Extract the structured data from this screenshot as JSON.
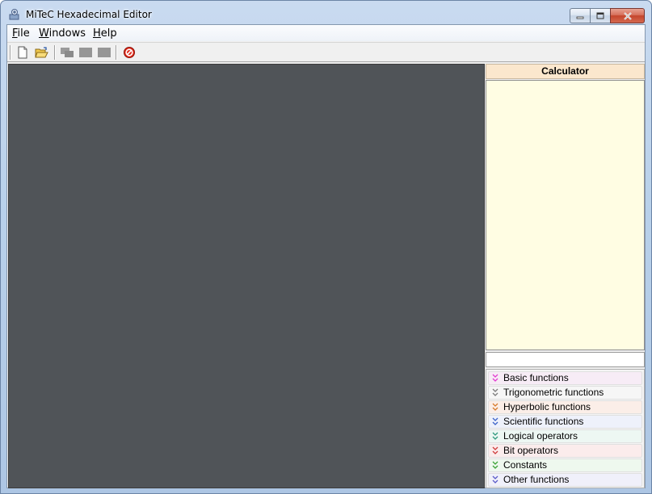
{
  "window": {
    "title": "MiTeC Hexadecimal Editor",
    "icons": [
      "app-icon",
      "minimize-icon",
      "maximize-icon",
      "close-icon"
    ]
  },
  "menubar": {
    "items": [
      {
        "label_ul": "F",
        "label_rest": "ile"
      },
      {
        "label_ul": "W",
        "label_rest": "indows"
      },
      {
        "label_ul": "H",
        "label_rest": "elp"
      }
    ]
  },
  "toolbar": {
    "buttons": [
      "new-file-icon",
      "open-folder-icon",
      "cascade-icon",
      "tile-icon",
      "arrange-icon",
      "stop-icon"
    ]
  },
  "calculator": {
    "title": "Calculator",
    "input_value": "",
    "groups": [
      {
        "label": "Basic functions",
        "color": "#e33bd0",
        "bg": "#f7ecf6"
      },
      {
        "label": "Trigonometric functions",
        "color": "#7a7a7a",
        "bg": "#f6f6f6"
      },
      {
        "label": "Hyperbolic functions",
        "color": "#d77a2c",
        "bg": "#fbeee8"
      },
      {
        "label": "Scientific functions",
        "color": "#3c63c9",
        "bg": "#eef1fb"
      },
      {
        "label": "Logical operators",
        "color": "#2f9a7e",
        "bg": "#edf7f3"
      },
      {
        "label": "Bit operators",
        "color": "#cf3b3b",
        "bg": "#fbecec"
      },
      {
        "label": "Constants",
        "color": "#3aa335",
        "bg": "#eef8ee"
      },
      {
        "label": "Other functions",
        "color": "#5a5ac8",
        "bg": "#f0f0fa"
      }
    ]
  },
  "colors": {
    "workspace": "#505458",
    "calc_display": "#fffde3",
    "calc_header": "#fbe7cd"
  }
}
